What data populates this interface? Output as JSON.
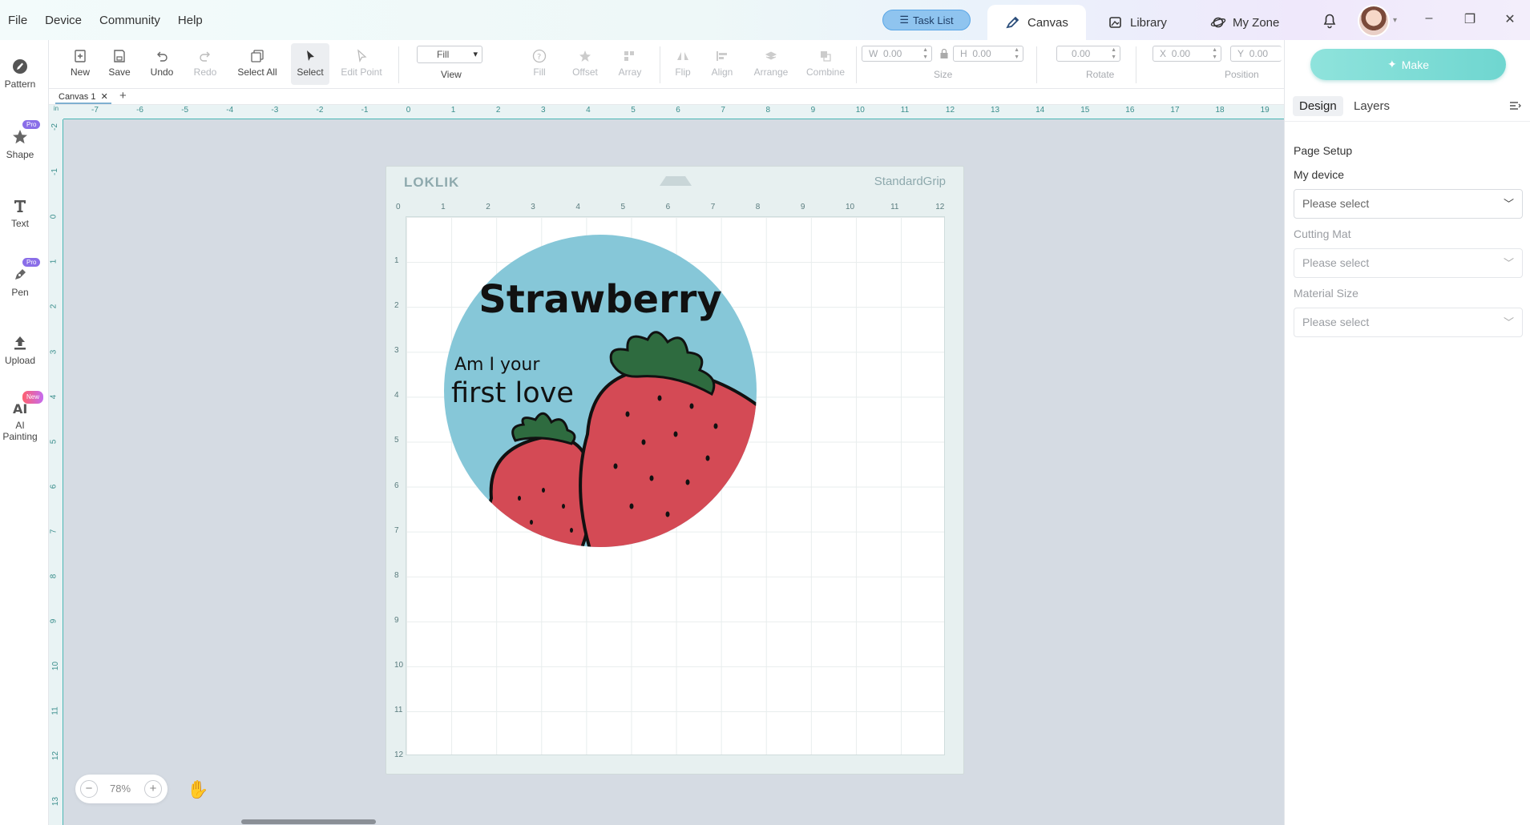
{
  "menu": [
    "File",
    "Device",
    "Community",
    "Help"
  ],
  "task_list": "Task List",
  "nav": {
    "canvas": "Canvas",
    "library": "Library",
    "myzone": "My Zone"
  },
  "window": {
    "minimize": "–",
    "restore": "❐",
    "close": "✕"
  },
  "left_tools": [
    {
      "label": "Pattern",
      "badge": ""
    },
    {
      "label": "Shape",
      "badge": "Pro"
    },
    {
      "label": "Text",
      "badge": ""
    },
    {
      "label": "Pen",
      "badge": "Pro"
    },
    {
      "label": "Upload",
      "badge": ""
    },
    {
      "label": "AI Painting",
      "badge": "New"
    }
  ],
  "toolbar": {
    "new": "New",
    "save": "Save",
    "undo": "Undo",
    "redo": "Redo",
    "select_all": "Select All",
    "select": "Select",
    "edit_point": "Edit Point",
    "view_value": "Fill",
    "view": "View",
    "fill": "Fill",
    "offset": "Offset",
    "array": "Array",
    "flip": "Flip",
    "align": "Align",
    "arrange": "Arrange",
    "combine": "Combine",
    "w_label": "W",
    "w_value": "0.00",
    "h_label": "H",
    "h_value": "0.00",
    "size": "Size",
    "rotate_value": "0.00",
    "rotate": "Rotate",
    "x_label": "X",
    "x_value": "0.00",
    "y_label": "Y",
    "y_value": "0.00",
    "position": "Position"
  },
  "doc_tab": "Canvas 1",
  "ruler": {
    "unit": "in",
    "h_labels": [
      "-7",
      "-6",
      "-5",
      "-4",
      "-3",
      "-2",
      "-1",
      "0",
      "1",
      "2",
      "3",
      "4",
      "5",
      "6",
      "7",
      "8",
      "9",
      "10",
      "11",
      "12",
      "13",
      "14",
      "15",
      "16",
      "17",
      "18",
      "19"
    ],
    "v_labels": [
      "-2",
      "-1",
      "0",
      "1",
      "2",
      "3",
      "4",
      "5",
      "6",
      "7",
      "8",
      "9",
      "10",
      "11",
      "12",
      "13"
    ]
  },
  "mat": {
    "logo": "LOKLIK",
    "grip": "StandardGrip",
    "x_labels": [
      "0",
      "1",
      "2",
      "3",
      "4",
      "5",
      "6",
      "7",
      "8",
      "9",
      "10",
      "11",
      "12"
    ],
    "y_labels": [
      "1",
      "2",
      "3",
      "4",
      "5",
      "6",
      "7",
      "8",
      "9",
      "10",
      "11",
      "12"
    ]
  },
  "design": {
    "title": "Strawberry",
    "line1": "Am I your",
    "line2": "first love",
    "bg": "#86c7d8",
    "berry": "#d44a55",
    "leaf": "#2e6b3f"
  },
  "zoom": {
    "value": "78%",
    "minus": "−",
    "plus": "+"
  },
  "right": {
    "make": "Make",
    "tabs": {
      "design": "Design",
      "layers": "Layers"
    },
    "page_setup": "Page Setup",
    "my_device": "My device",
    "device_value": "Please select",
    "cutting_mat": "Cutting Mat",
    "mat_value": "Please select",
    "material_size": "Material Size",
    "size_value": "Please select"
  }
}
